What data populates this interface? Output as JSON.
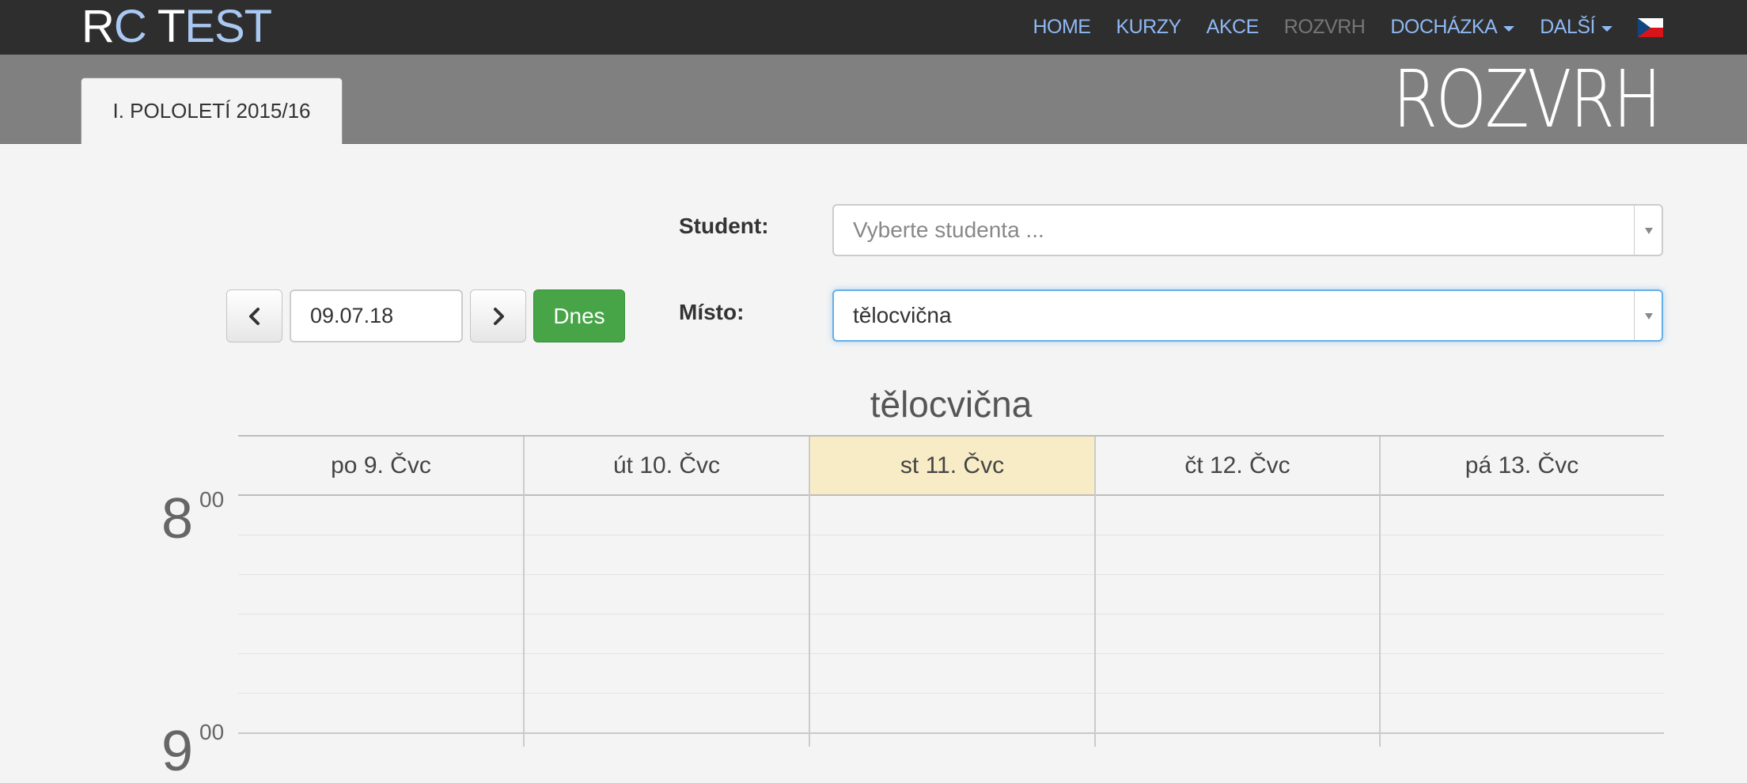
{
  "navbar": {
    "brand_parts": [
      "R",
      "C",
      " T",
      "EST"
    ],
    "items": [
      {
        "label": "HOME",
        "active": false,
        "dropdown": false
      },
      {
        "label": "KURZY",
        "active": false,
        "dropdown": false
      },
      {
        "label": "AKCE",
        "active": false,
        "dropdown": false
      },
      {
        "label": "ROZVRH",
        "active": true,
        "dropdown": false
      },
      {
        "label": "DOCHÁZKA",
        "active": false,
        "dropdown": true
      },
      {
        "label": "DALŠÍ",
        "active": false,
        "dropdown": true
      }
    ],
    "language_flag": "czech-flag-icon"
  },
  "header": {
    "tab_label": "I. POLOLETÍ 2015/16",
    "page_title": "ROZVRH"
  },
  "form": {
    "student_label": "Student:",
    "student_placeholder": "Vyberte studenta ...",
    "place_label": "Místo:",
    "place_value": "tělocvična",
    "date_value": "09.07.18",
    "today_button": "Dnes",
    "prev_icon": "chevron-left-icon",
    "next_icon": "chevron-right-icon"
  },
  "calendar": {
    "title": "tělocvična",
    "days": [
      {
        "label": "po 9. Čvc",
        "today": false
      },
      {
        "label": "út 10. Čvc",
        "today": false
      },
      {
        "label": "st 11. Čvc",
        "today": true
      },
      {
        "label": "čt 12. Čvc",
        "today": false
      },
      {
        "label": "pá 13. Čvc",
        "today": false
      }
    ],
    "hours": [
      {
        "hour": "8",
        "minutes": "00"
      },
      {
        "hour": "9",
        "minutes": "00"
      }
    ]
  },
  "colors": {
    "navbar_bg": "#2e2e2e",
    "nav_link": "#8fb9f4",
    "band_bg": "#808080",
    "today_highlight": "#f8ecc6",
    "today_button": "#47a447"
  }
}
